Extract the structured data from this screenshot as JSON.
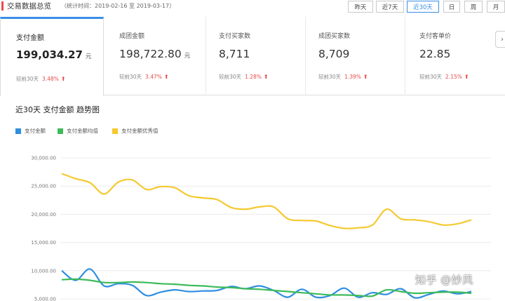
{
  "header": {
    "title": "交易数据总览",
    "stat_time": "（统计时间：2019-02-16 至 2019-03-17）"
  },
  "range_buttons": [
    {
      "label": "昨天",
      "active": false
    },
    {
      "label": "近7天",
      "active": false
    },
    {
      "label": "近30天",
      "active": true
    },
    {
      "label": "日",
      "active": false
    },
    {
      "label": "周",
      "active": false
    },
    {
      "label": "月",
      "active": false
    }
  ],
  "metrics": [
    {
      "label": "支付金额",
      "value": "199,034.27",
      "unit": "元",
      "compare_label": "较前30天",
      "compare_pct": "3.48%",
      "trend": "up",
      "active": true
    },
    {
      "label": "成团金额",
      "value": "198,722.80",
      "unit": "元",
      "compare_label": "较前30天",
      "compare_pct": "3.47%",
      "trend": "up",
      "active": false
    },
    {
      "label": "支付买家数",
      "value": "8,711",
      "unit": "",
      "compare_label": "较前30天",
      "compare_pct": "1.28%",
      "trend": "up",
      "active": false
    },
    {
      "label": "成团买家数",
      "value": "8,709",
      "unit": "",
      "compare_label": "较前30天",
      "compare_pct": "1.39%",
      "trend": "up",
      "active": false
    },
    {
      "label": "支付客单价",
      "value": "22.85",
      "unit": "",
      "compare_label": "较前30天",
      "compare_pct": "2.15%",
      "trend": "up",
      "active": false
    }
  ],
  "chart_section_title": "近30天 支付金额 趋势图",
  "watermark": "知乎 @妙风",
  "colors": {
    "accent": "#3a8ee6",
    "up": "#e84a4a",
    "series_blue": "#2f8ee0",
    "series_green": "#3dbb5a",
    "series_yellow": "#f5c930"
  },
  "chart_data": {
    "type": "line",
    "title": "近30天 支付金额 趋势图",
    "legend_position": "top-left",
    "grid": true,
    "ylim": [
      5000,
      30000
    ],
    "y_ticks": [
      5000,
      10000,
      15000,
      20000,
      25000,
      30000
    ],
    "y_tick_labels": [
      "5,000.00",
      "10,000.00",
      "15,000.00",
      "20,000.00",
      "25,000.00",
      "30,000.00"
    ],
    "x": [
      1,
      2,
      3,
      4,
      5,
      6,
      7,
      8,
      9,
      10,
      11,
      12,
      13,
      14,
      15,
      16,
      17,
      18,
      19,
      20,
      21,
      22,
      23,
      24,
      25,
      26,
      27,
      28,
      29,
      30
    ],
    "series": [
      {
        "name": "支付金额",
        "color": "#2f8ee0",
        "values": [
          10000,
          8300,
          10300,
          7300,
          7700,
          7400,
          5600,
          6200,
          6600,
          6300,
          6400,
          6500,
          7200,
          6800,
          7300,
          6500,
          5300,
          6700,
          5300,
          5600,
          6900,
          5300,
          6100,
          5800,
          6800,
          5200,
          5800,
          6400,
          5900,
          6300
        ]
      },
      {
        "name": "支付金额均值",
        "color": "#3dbb5a",
        "values": [
          8400,
          8500,
          8300,
          7900,
          7900,
          8000,
          7900,
          7700,
          7600,
          7400,
          7300,
          7100,
          7000,
          6800,
          6700,
          6500,
          6300,
          6100,
          5900,
          5700,
          5700,
          5600,
          5500,
          6600,
          6300,
          6000,
          6100,
          6200,
          6200,
          6000
        ]
      },
      {
        "name": "支付金额优秀值",
        "color": "#f5c930",
        "values": [
          27200,
          26300,
          25600,
          23600,
          25700,
          26100,
          24400,
          24900,
          24700,
          23300,
          22900,
          22600,
          21200,
          20900,
          21300,
          21300,
          19200,
          18900,
          18800,
          18000,
          17500,
          17600,
          18100,
          20900,
          19200,
          19000,
          18700,
          18100,
          18300,
          19000
        ]
      }
    ]
  }
}
